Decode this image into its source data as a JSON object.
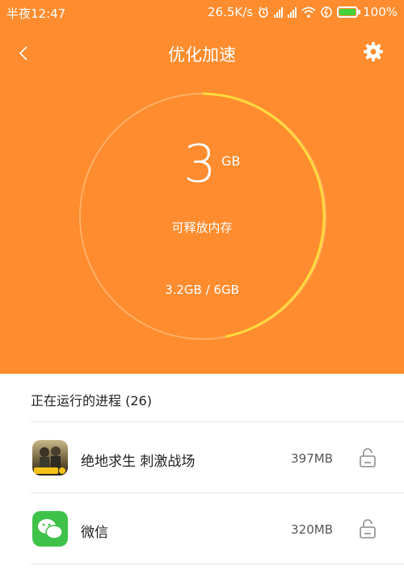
{
  "status_bar": {
    "time": "半夜12:47",
    "speed": "26.5K/s",
    "battery": "100%"
  },
  "header": {
    "title": "优化加速"
  },
  "memory": {
    "value": "3",
    "unit": "GB",
    "label": "可释放内存",
    "usage": "3.2GB / 6GB"
  },
  "process_list": {
    "title": "正在运行的进程 (26)",
    "items": [
      {
        "name": "绝地求生 刺激战场",
        "size": "397MB",
        "icon": "pubg-app-icon"
      },
      {
        "name": "微信",
        "size": "320MB",
        "icon": "wechat-app-icon"
      }
    ]
  },
  "colors": {
    "accent": "#ff8c2e",
    "progress": "#ffd93d",
    "wechat": "#3fc24a"
  }
}
